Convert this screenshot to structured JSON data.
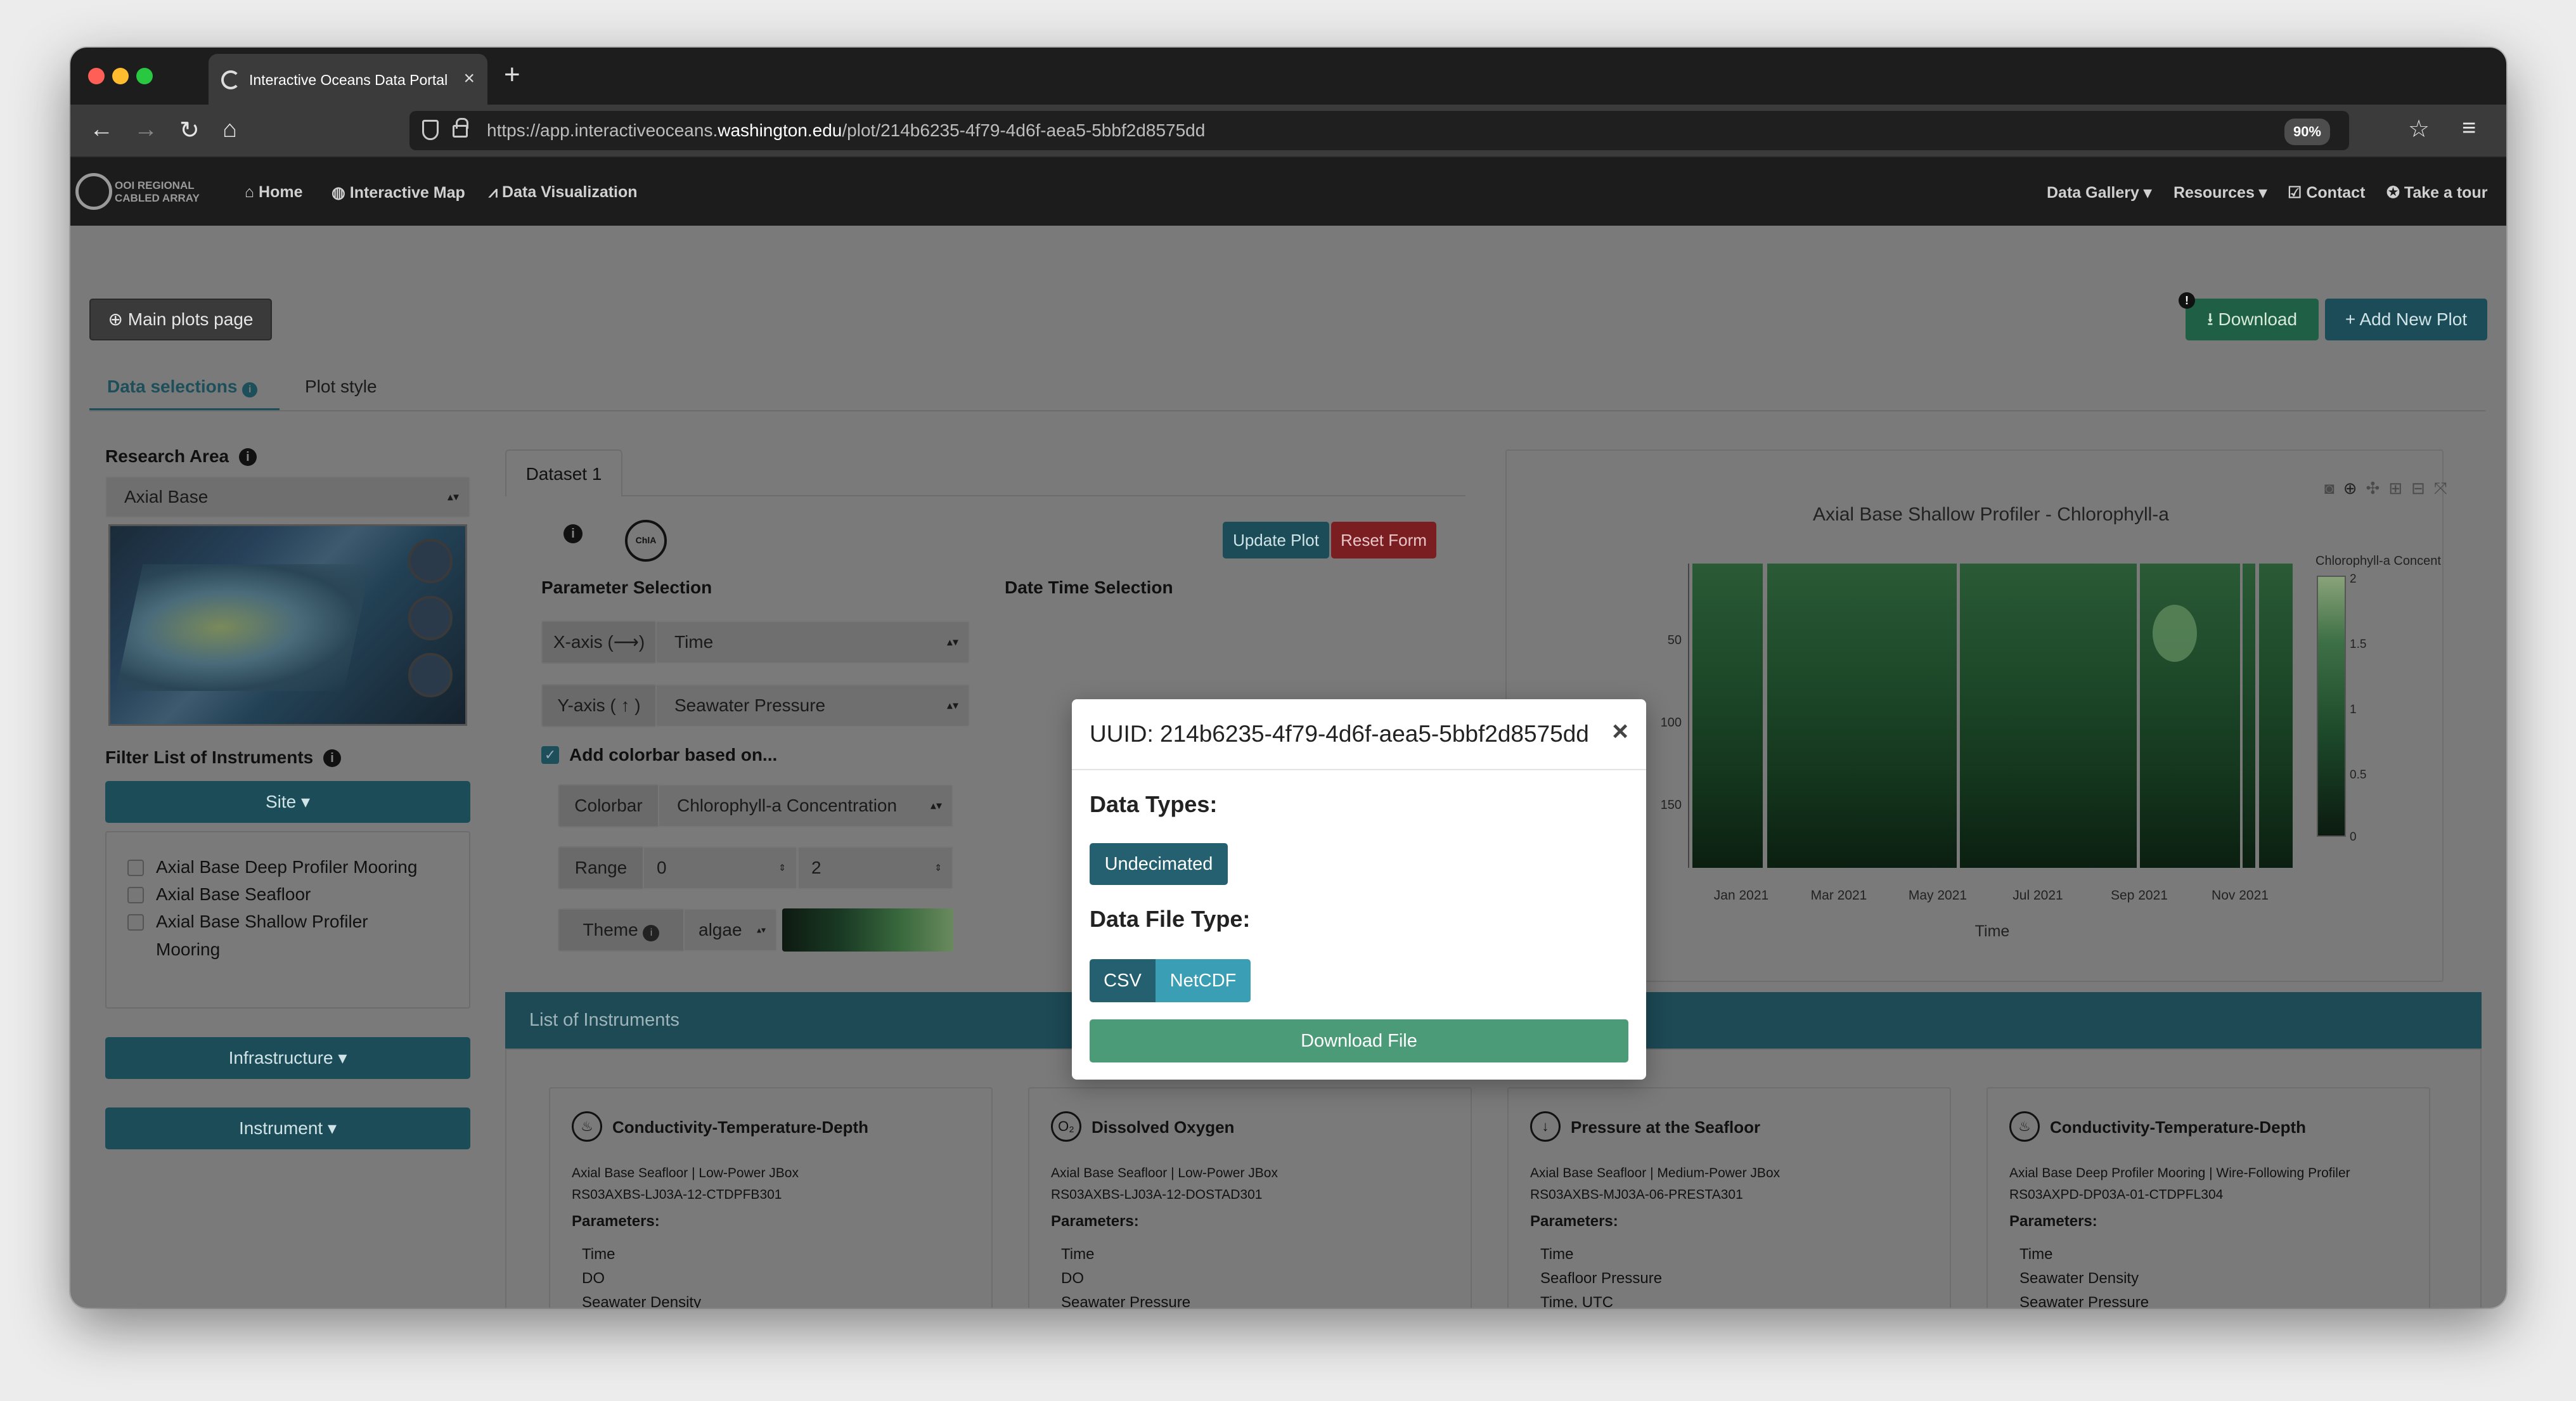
{
  "browser": {
    "tab_title": "Interactive Oceans Data Portal",
    "url_prefix": "https://app.interactiveoceans.",
    "url_domain": "washington.edu",
    "url_path": "/plot/214b6235-4f79-4d6f-aea5-5bbf2d8575dd",
    "zoom": "90%"
  },
  "site": {
    "logo_line1": "OOI REGIONAL",
    "logo_line2": "CABLED ARRAY",
    "nav_left": [
      "Home",
      "Interactive Map",
      "Data Visualization"
    ],
    "nav_right": [
      "Data Gallery",
      "Resources",
      "Contact",
      "Take a tour"
    ]
  },
  "actions": {
    "main_plots": "Main plots page",
    "download": "Download",
    "download_badge": "!",
    "add_new_plot": "+ Add New Plot"
  },
  "tabs": {
    "data_selections": "Data selections",
    "plot_style": "Plot style"
  },
  "left": {
    "research_area_label": "Research Area",
    "research_area_value": "Axial Base",
    "filter_label": "Filter List of Instruments",
    "site_btn": "Site",
    "sites": [
      "Axial Base Deep Profiler Mooring",
      "Axial Base Seafloor",
      "Axial Base Shallow Profiler",
      "Mooring"
    ],
    "infrastructure_btn": "Infrastructure",
    "instrument_btn": "Instrument"
  },
  "dataset": {
    "tab": "Dataset 1",
    "chip": "ChlA",
    "update_plot": "Update Plot",
    "reset_form": "Reset Form",
    "param_selection": "Parameter Selection",
    "date_time_selection": "Date Time Selection",
    "xaxis_label": "X-axis (⟶)",
    "xaxis_value": "Time",
    "yaxis_label": "Y-axis ( ↑ )",
    "yaxis_value": "Seawater Pressure",
    "add_colorbar": "Add colorbar based on...",
    "colorbar_label": "Colorbar",
    "colorbar_value": "Chlorophyll-a Concentration",
    "range_label": "Range",
    "range_min": "0",
    "range_max": "2",
    "theme_label": "Theme",
    "theme_value": "algae"
  },
  "chart": {
    "title": "Axial Base Shallow Profiler - Chlorophyll-a",
    "xlabel": "Time",
    "colorbar_title": "Chlorophyll-a Concentration",
    "x_ticks": [
      "Jan 2021",
      "Mar 2021",
      "May 2021",
      "Jul 2021",
      "Sep 2021",
      "Nov 2021"
    ],
    "y_ticks": [
      "50",
      "100",
      "150"
    ],
    "cbar_ticks": [
      "2",
      "1.5",
      "1",
      "0.5",
      "0"
    ]
  },
  "instruments": {
    "header": "List of Instruments",
    "params_label": "Parameters:",
    "cards": [
      {
        "icon": "♨",
        "title": "Conductivity-Temperature-Depth",
        "line1": "Axial Base Seafloor | Low-Power JBox",
        "line2": "RS03AXBS-LJ03A-12-CTDPFB301",
        "params": [
          "Time",
          "DO",
          "Seawater Density"
        ]
      },
      {
        "icon": "O₂",
        "title": "Dissolved Oxygen",
        "line1": "Axial Base Seafloor | Low-Power JBox",
        "line2": "RS03AXBS-LJ03A-12-DOSTAD301",
        "params": [
          "Time",
          "DO",
          "Seawater Pressure"
        ]
      },
      {
        "icon": "↓",
        "title": "Pressure at the Seafloor",
        "line1": "Axial Base Seafloor | Medium-Power JBox",
        "line2": "RS03AXBS-MJ03A-06-PRESTA301",
        "params": [
          "Time",
          "Seafloor Pressure",
          "Time, UTC"
        ]
      },
      {
        "icon": "♨",
        "title": "Conductivity-Temperature-Depth",
        "line1": "Axial Base Deep Profiler Mooring | Wire-Following Profiler",
        "line2": "RS03AXPD-DP03A-01-CTDPFL304",
        "params": [
          "Time",
          "Seawater Density",
          "Seawater Pressure"
        ]
      }
    ]
  },
  "modal": {
    "title": "UUID: 214b6235-4f79-4d6f-aea5-5bbf2d8575dd",
    "close": "×",
    "data_types_label": "Data Types:",
    "undecimated": "Undecimated",
    "file_type_label": "Data File Type:",
    "csv": "CSV",
    "netcdf": "NetCDF",
    "download_file": "Download File"
  }
}
